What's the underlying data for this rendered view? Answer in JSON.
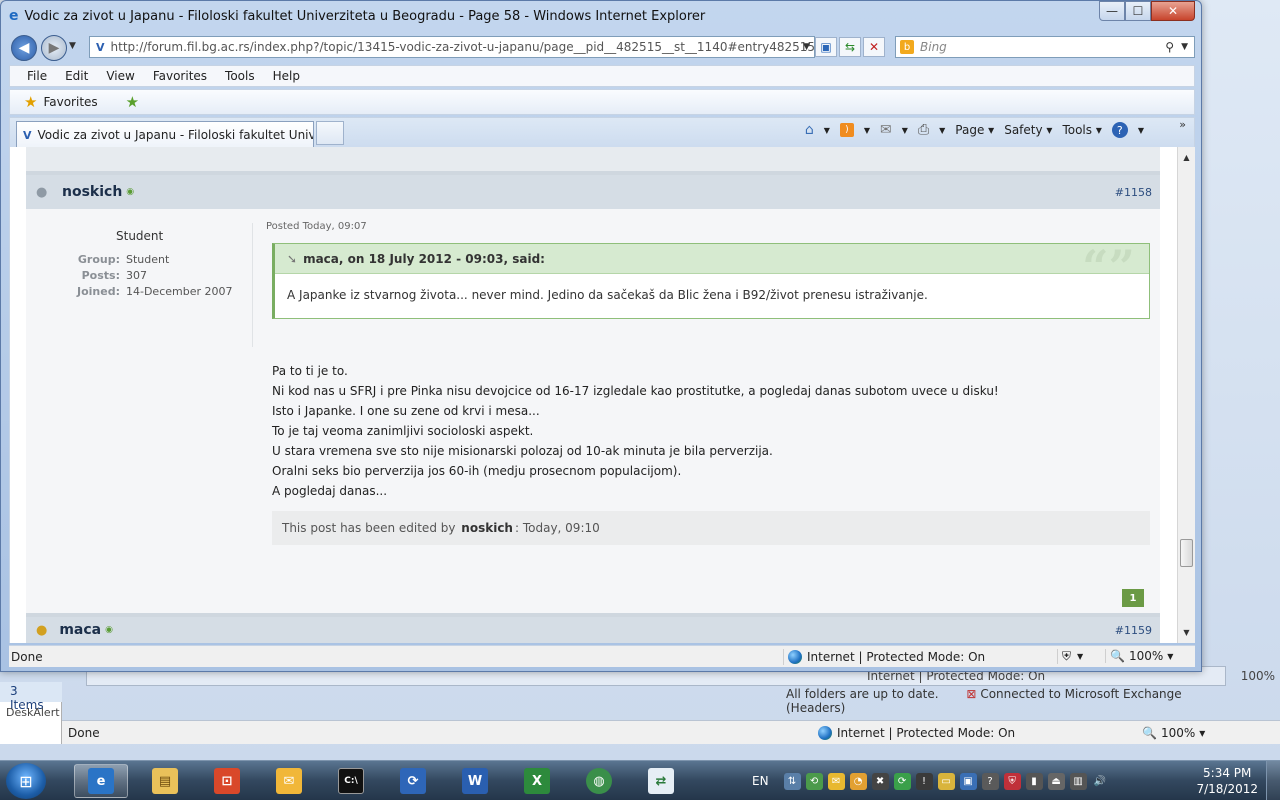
{
  "window": {
    "title": "Vodic za zivot u Japanu - Filoloski fakultet Univerziteta u Beogradu - Page 58 - Windows Internet Explorer",
    "min": "—",
    "max": "☐",
    "close": "✕"
  },
  "address": {
    "url": "http://forum.fil.bg.ac.rs/index.php?/topic/13415-vodic-za-zivot-u-japanu/page__pid__482515__st__1140#entry482515",
    "search_placeholder": "Bing"
  },
  "menu": [
    "File",
    "Edit",
    "View",
    "Favorites",
    "Tools",
    "Help"
  ],
  "favorites_label": "Favorites",
  "tab": {
    "title": "Vodic za zivot u Japanu - Filoloski fakultet Univer..."
  },
  "commands": {
    "page": "Page",
    "safety": "Safety",
    "tools": "Tools"
  },
  "post": {
    "username": "noskich",
    "number": "#1158",
    "rank": "Student",
    "group_label": "Group:",
    "group": "Student",
    "posts_label": "Posts:",
    "posts": "307",
    "joined_label": "Joined:",
    "joined": "14-December 2007",
    "posted": "Posted Today, 09:07",
    "quote_header": "maca, on 18 July 2012 - 09:03, said:",
    "quote_body": "A Japanke iz stvarnog života... never mind. Jedino da sačekaš da Blic žena i B92/život prenesu istraživanje.",
    "lines": [
      "Pa to ti je to.",
      "Ni kod nas u SFRJ i pre Pinka nisu devojcice od 16-17 izgledale kao prostitutke, a pogledaj danas subotom uvece u disku!",
      "Isto i Japanke. I one su zene od krvi i mesa...",
      "To je taj veoma zanimljivi socioloski aspekt.",
      "U stara vremena sve sto nije misionarski polozaj od 10-ak minuta je bila perverzija.",
      "Oralni seks bio perverzija jos 60-ih (medju prosecnom populacijom).",
      "A pogledaj danas..."
    ],
    "edited_prefix": "This post has been edited by",
    "edited_by": "noskich",
    "edited_time": ": Today, 09:10",
    "reputation": "1"
  },
  "next_post": {
    "username": "maca",
    "number": "#1159"
  },
  "status": {
    "done": "Done",
    "zone": "Internet | Protected Mode: On",
    "zoom": "100%"
  },
  "background": {
    "items": "3 Items",
    "desktop": "DeskAlert",
    "outlook_status": "Internet | Protected Mode: On",
    "outlook_folders": "All folders are up to date.",
    "outlook_exchange": "Connected to Microsoft Exchange (Headers)",
    "outlook_zoom": "100%",
    "ie2_done": "Done",
    "ie2_zone": "Internet | Protected Mode: On",
    "ie2_zoom": "100%"
  },
  "taskbar": {
    "lang": "EN",
    "time": "5:34 PM",
    "date": "7/18/2012",
    "apps": [
      "internet-explorer",
      "windows-explorer",
      "outlook-web",
      "outlook",
      "command-prompt",
      "remote-desktop",
      "word",
      "excel",
      "network",
      "transfer"
    ]
  },
  "colors": {
    "accent": "#2b5fb0",
    "quote_green": "#d6ead0",
    "post_header": "#d5dde5"
  }
}
